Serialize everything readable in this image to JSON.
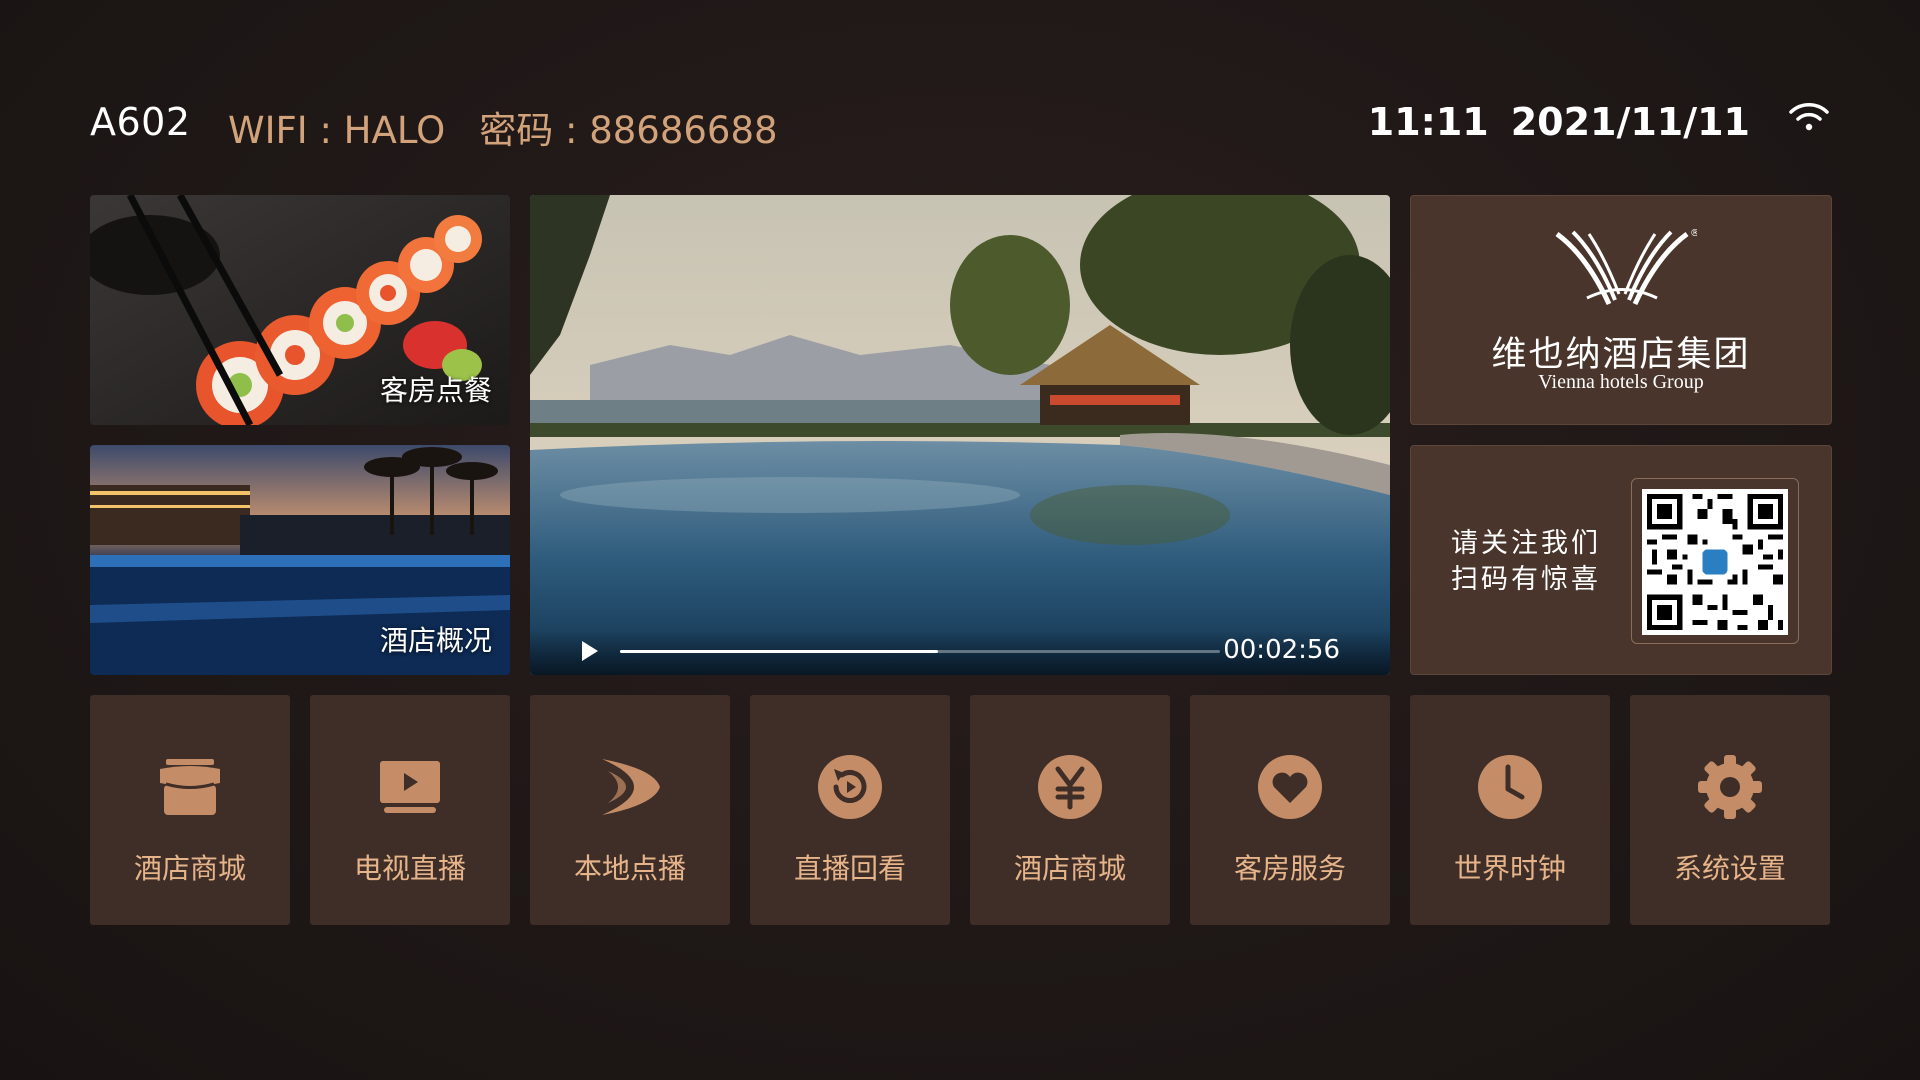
{
  "header": {
    "room": "A602",
    "wifi": "WIFI : HALO",
    "password": "密码 : 88686688",
    "time": "11:11",
    "date": "2021/11/11",
    "wifi_icon": "wifi-icon"
  },
  "tiles": {
    "dining": {
      "label": "客房点餐"
    },
    "hotel": {
      "label": "酒店概况"
    }
  },
  "video": {
    "time": "00:02:56",
    "progress": 0.53
  },
  "brand": {
    "name_cn": "维也纳酒店集团",
    "name_en": "Vienna hotels Group",
    "registered": "®"
  },
  "follow": {
    "line1": "请关注我们",
    "line2": "扫码有惊喜"
  },
  "apps": [
    {
      "label": "酒店商城",
      "icon": "store-icon"
    },
    {
      "label": "电视直播",
      "icon": "tv-icon"
    },
    {
      "label": "本地点播",
      "icon": "vod-icon"
    },
    {
      "label": "直播回看",
      "icon": "replay-icon"
    },
    {
      "label": "酒店商城",
      "icon": "yuan-icon"
    },
    {
      "label": "客房服务",
      "icon": "heart-icon"
    },
    {
      "label": "世界时钟",
      "icon": "clock-icon"
    },
    {
      "label": "系统设置",
      "icon": "gear-icon"
    }
  ],
  "colors": {
    "accent": "#d2a27a",
    "icon_fill": "#c58d67",
    "tile_bg": "#3e2e27",
    "panel_bg": "#4a352c"
  }
}
